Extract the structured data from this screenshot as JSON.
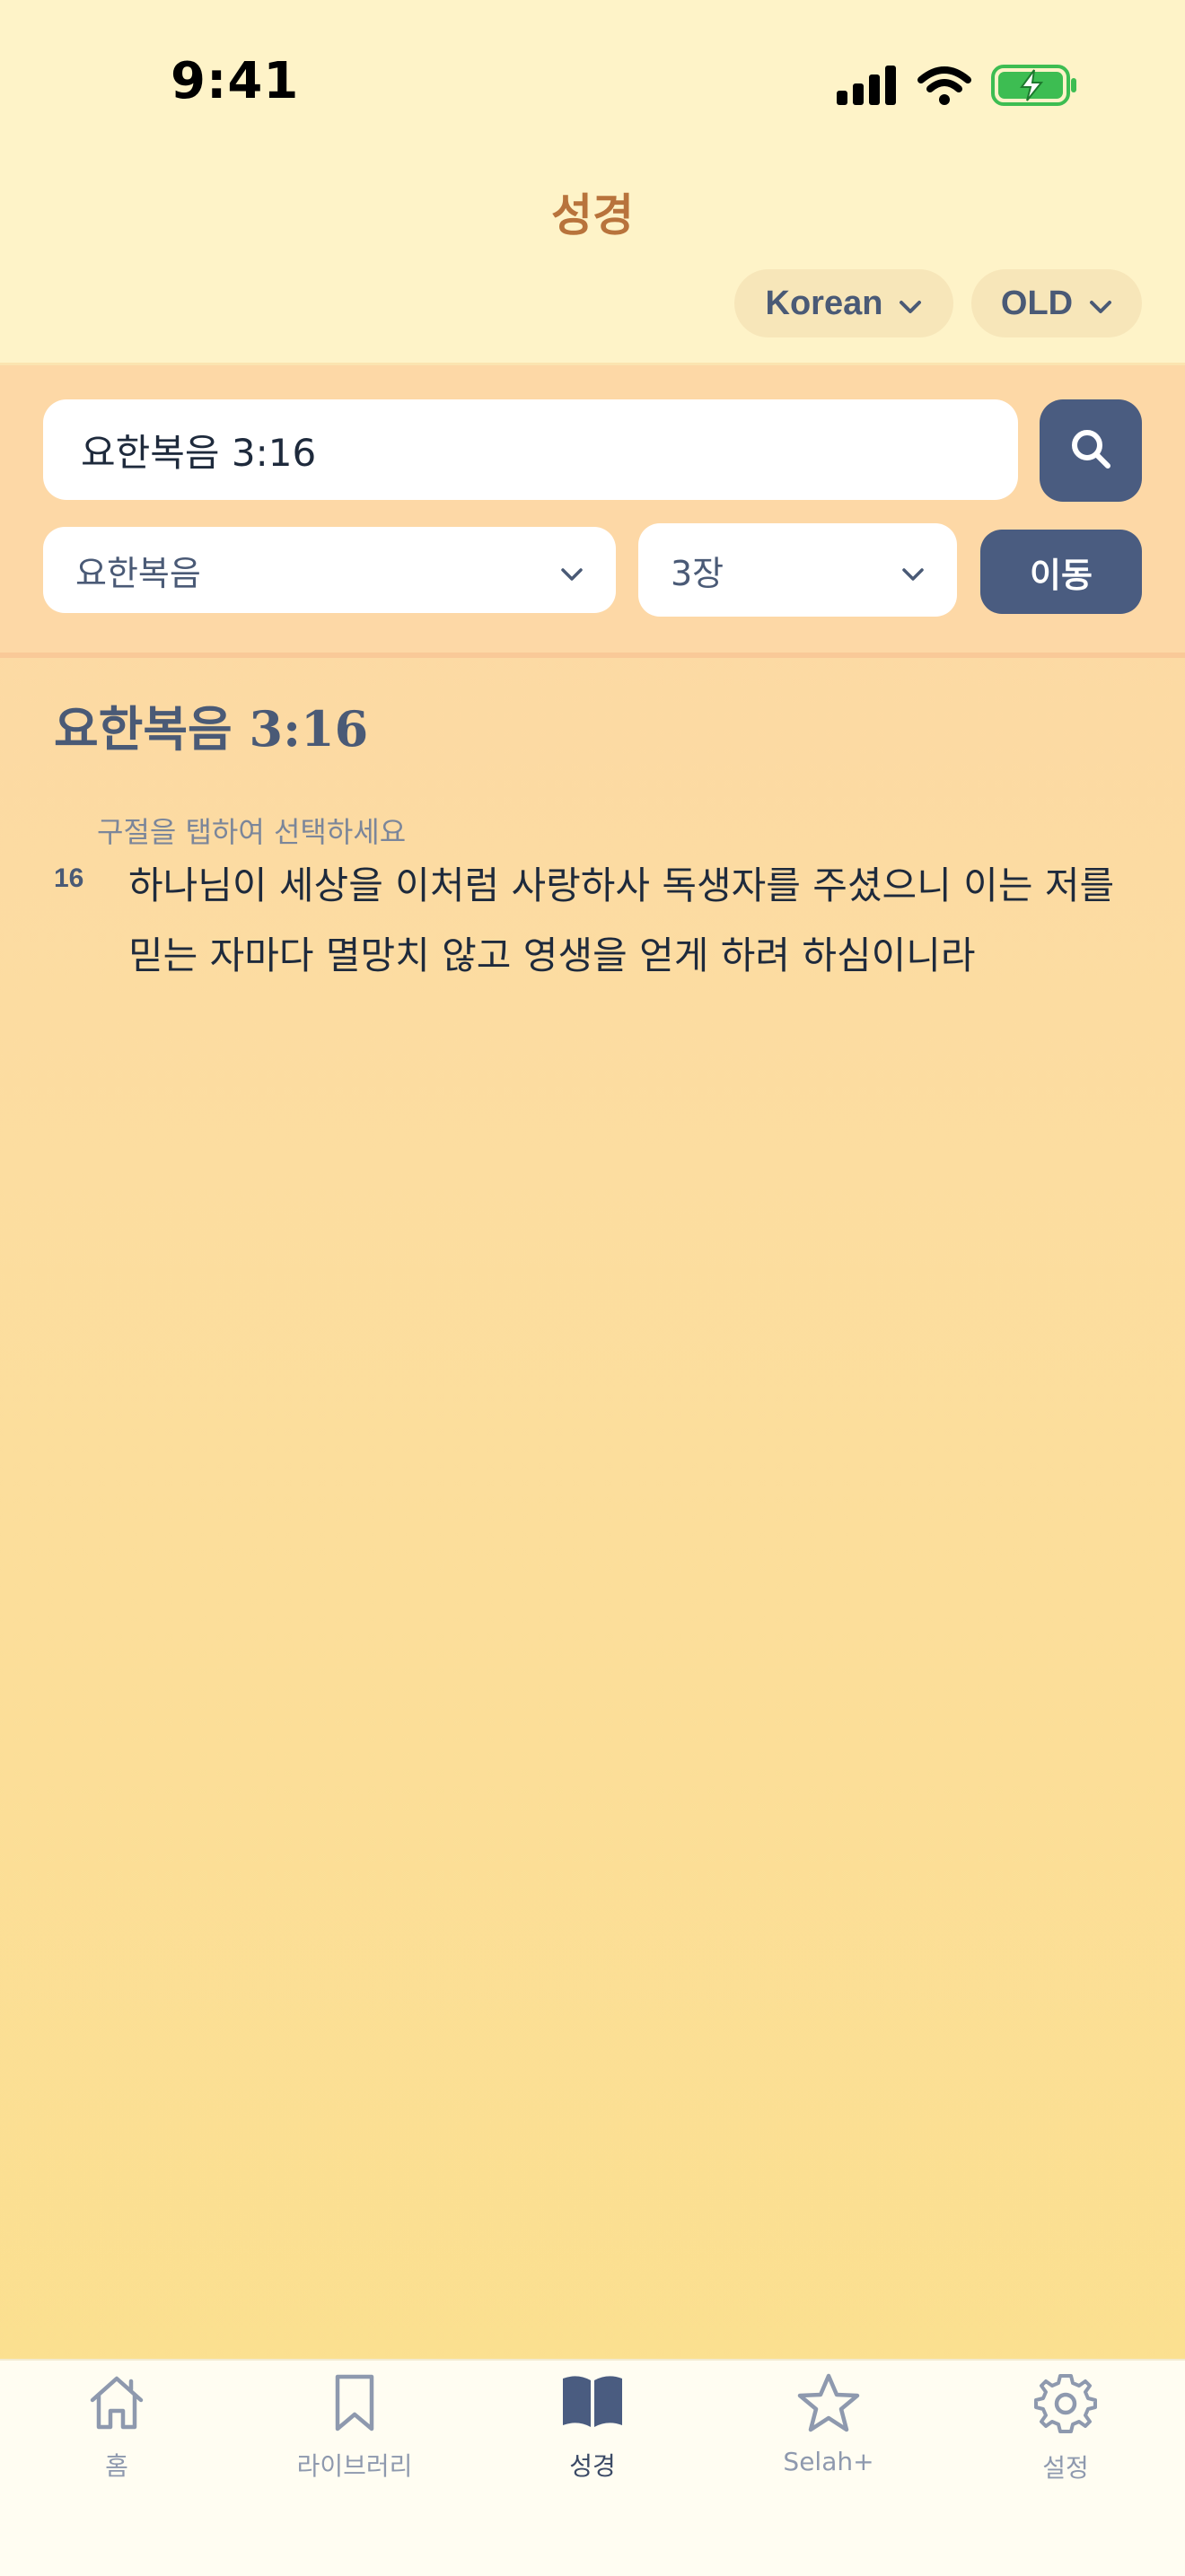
{
  "status_bar": {
    "time": "9:41"
  },
  "header": {
    "title": "성경",
    "language_pill": "Korean",
    "version_pill": "OLD"
  },
  "search": {
    "value": "요한복음 3:16",
    "book_select": "요한복음",
    "chapter_select": "3장",
    "go_label": "이동"
  },
  "content": {
    "reference": "요한복음 3:16",
    "hint": "구절을 탭하여 선택하세요",
    "verses": [
      {
        "number": "16",
        "text": "하나님이 세상을 이처럼 사랑하사 독생자를 주셨으니 이는 저를 믿는 자마다 멸망치 않고 영생을 얻게 하려 하심이니라"
      }
    ]
  },
  "tabbar": {
    "items": [
      {
        "label": "홈",
        "icon": "home-icon"
      },
      {
        "label": "라이브러리",
        "icon": "bookmark-icon"
      },
      {
        "label": "성경",
        "icon": "book-icon",
        "active": true
      },
      {
        "label": "Selah+",
        "icon": "star-icon"
      },
      {
        "label": "설정",
        "icon": "gear-icon"
      }
    ]
  },
  "colors": {
    "accent": "#4a5c80",
    "title": "#b8733c",
    "header_bg": "#fef3c8"
  }
}
